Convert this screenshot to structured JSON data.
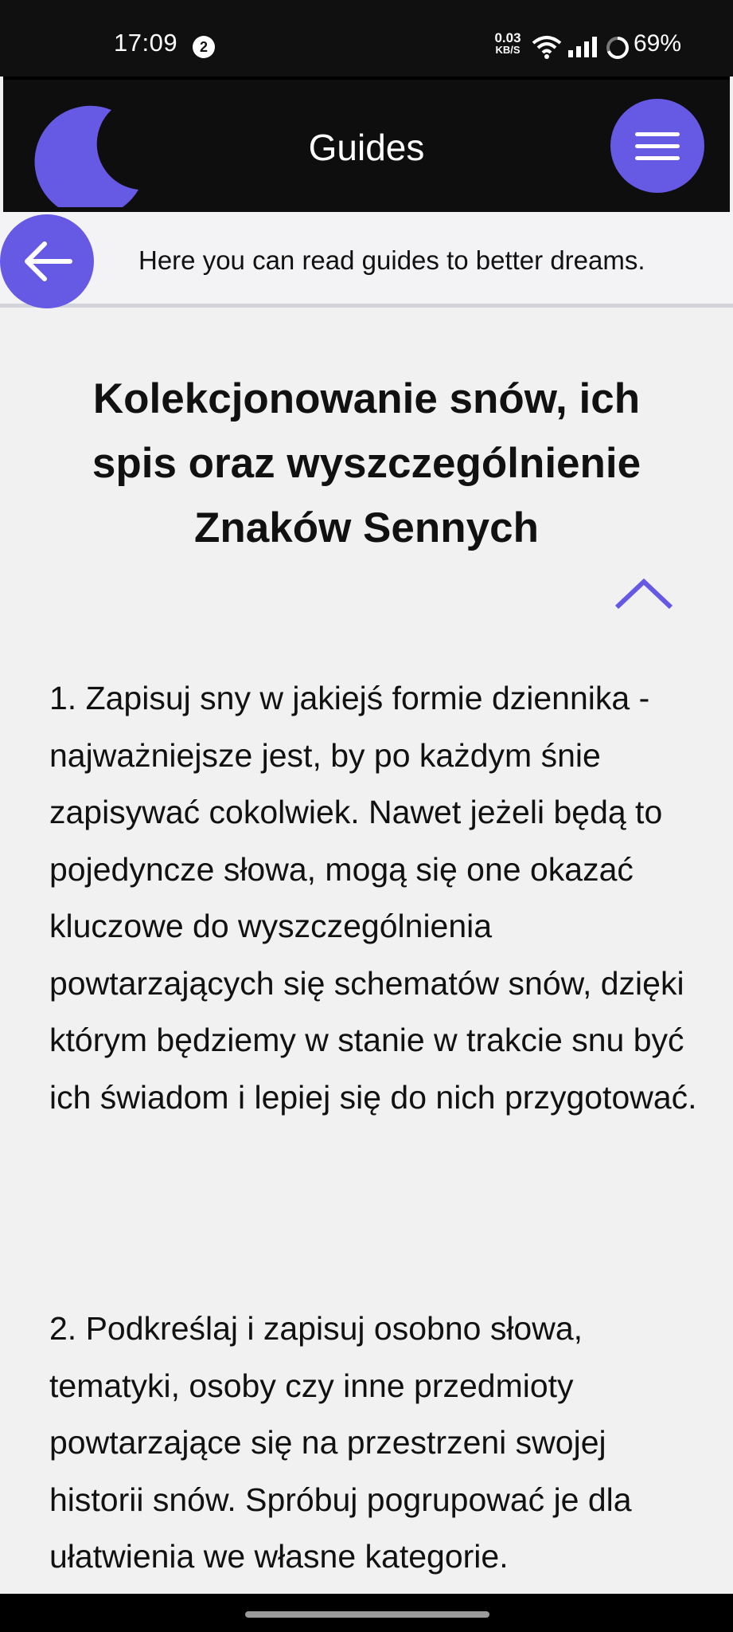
{
  "status_bar": {
    "time": "17:09",
    "notification_count": "2",
    "net_speed_value": "0.03",
    "net_speed_unit": "KB/S",
    "battery": "69%"
  },
  "header": {
    "title": "Guides",
    "logo": "crescent-moon",
    "menu_icon": "hamburger-icon",
    "accent_color": "#6659e4"
  },
  "subheader": {
    "back_icon": "arrow-left-icon",
    "text": "Here you can read guides to better dreams."
  },
  "article": {
    "title": "Kolekcjonowanie snów, ich spis oraz wyszczególnienie Znaków Sennych",
    "collapse_icon": "chevron-up-icon",
    "paragraphs": [
      "1. Zapisuj sny w jakiejś formie dziennika - najważniejsze jest, by po każdym śnie zapisywać cokolwiek. Nawet jeżeli będą to pojedyncze słowa, mogą się one okazać kluczowe do wyszczególnienia powtarzających się schematów snów, dzięki którym będziemy w stanie w trakcie snu być ich świadom i lepiej się do nich przygotować.",
      "2. Podkreślaj i zapisuj osobno słowa, tematyki, osoby czy inne przedmioty powtarzające się na przestrzeni swojej historii snów. Spróbuj pogrupować je dla ułatwienia we własne kategorie."
    ]
  }
}
